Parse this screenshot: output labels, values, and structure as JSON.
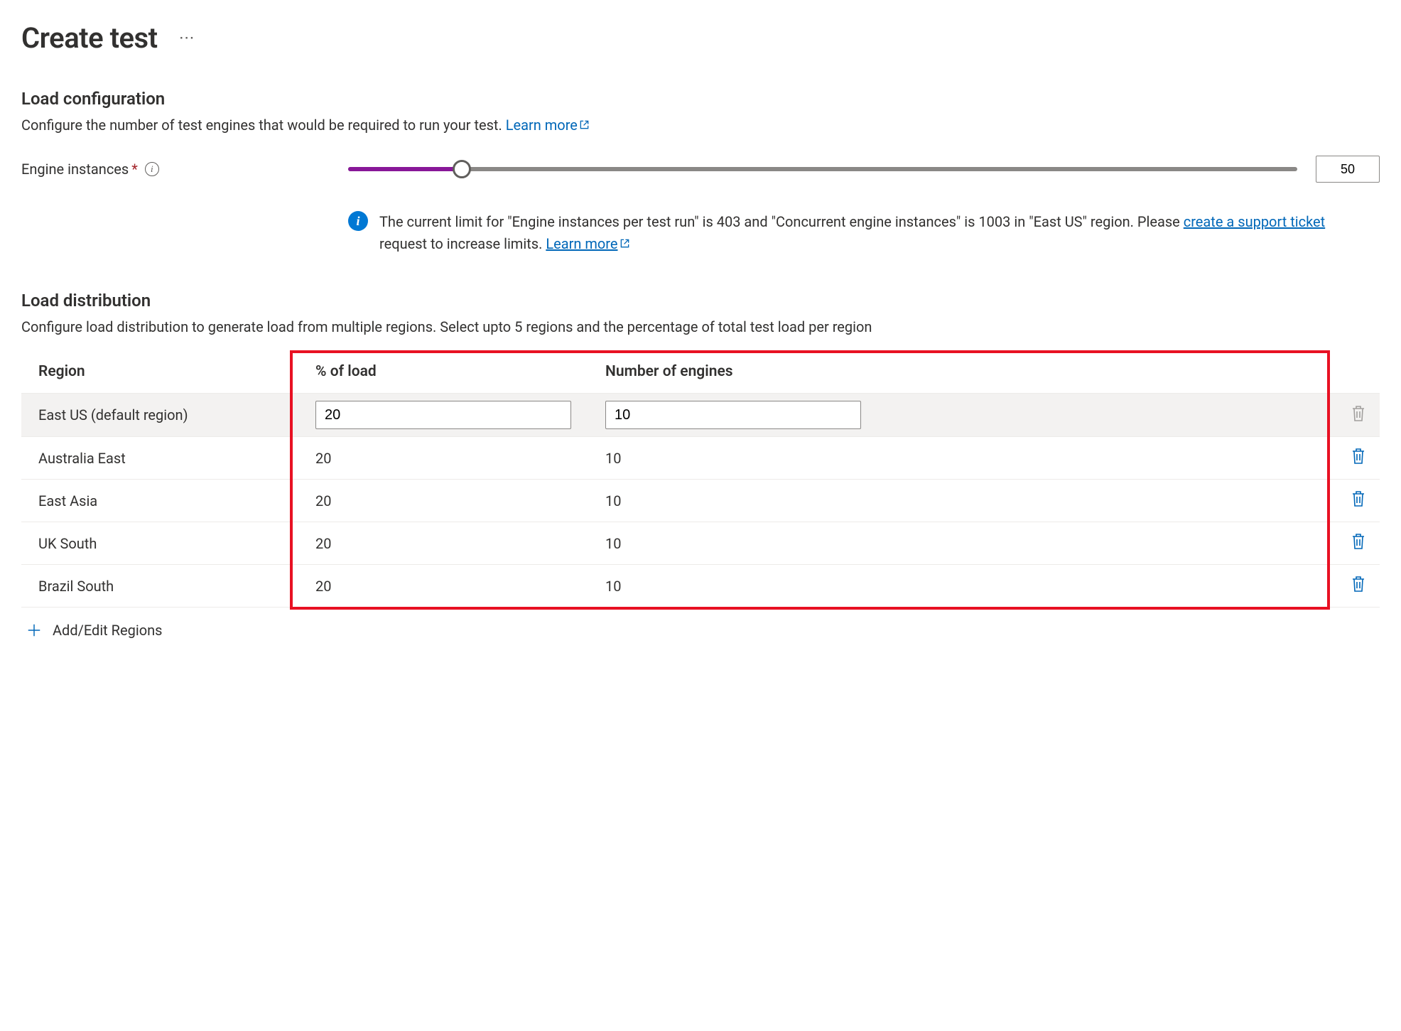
{
  "header": {
    "title": "Create test"
  },
  "load_config": {
    "title": "Load configuration",
    "description": "Configure the number of test engines that would be required to run your test.",
    "learn_more": "Learn more",
    "engine_label": "Engine instances",
    "engine_value": "50",
    "slider_percent": 12,
    "info_msg_1": "The current limit for \"Engine instances per test run\" is 403 and \"Concurrent engine instances\" is 1003 in \"East US\" region. Please ",
    "info_link_1": "create a support ticket",
    "info_msg_2": " request to increase limits. ",
    "info_link_2": "Learn more"
  },
  "load_dist": {
    "title": "Load distribution",
    "description": "Configure load distribution to generate load from multiple regions. Select upto 5 regions and the percentage of total test load per region",
    "col_region": "Region",
    "col_load": "% of load",
    "col_engines": "Number of engines",
    "rows": [
      {
        "region": "East US (default region)",
        "load": "20",
        "engines": "10",
        "default": true
      },
      {
        "region": "Australia East",
        "load": "20",
        "engines": "10",
        "default": false
      },
      {
        "region": "East Asia",
        "load": "20",
        "engines": "10",
        "default": false
      },
      {
        "region": "UK South",
        "load": "20",
        "engines": "10",
        "default": false
      },
      {
        "region": "Brazil South",
        "load": "20",
        "engines": "10",
        "default": false
      }
    ],
    "add_label": "Add/Edit Regions"
  }
}
